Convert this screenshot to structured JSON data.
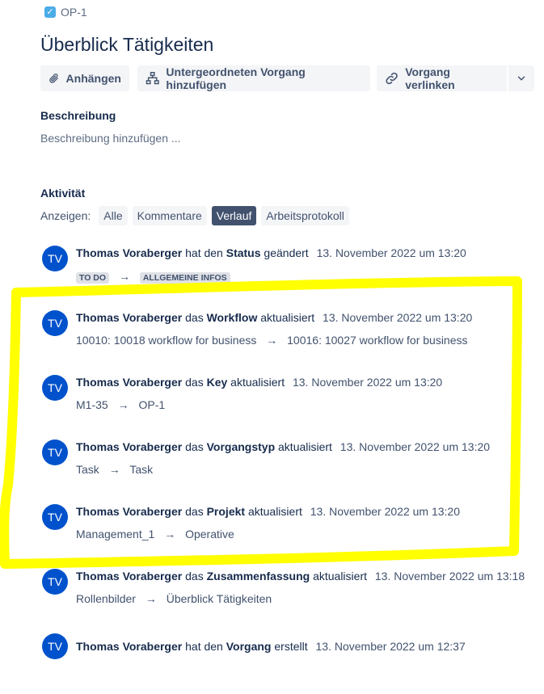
{
  "breadcrumb": {
    "key": "OP-1",
    "check_icon": "checkbox-checked-icon"
  },
  "issue": {
    "title": "Überblick Tätigkeiten"
  },
  "toolbar": {
    "attach": "Anhängen",
    "add_child": "Untergeordneten Vorgang hinzufügen",
    "link_issue": "Vorgang verlinken"
  },
  "description": {
    "label": "Beschreibung",
    "placeholder": "Beschreibung hinzufügen ..."
  },
  "activity": {
    "label": "Aktivität",
    "show_label": "Anzeigen:",
    "filters": [
      "Alle",
      "Kommentare",
      "Verlauf",
      "Arbeitsprotokoll"
    ],
    "active_filter": "Verlauf"
  },
  "entries": [
    {
      "initials": "TV",
      "author": "Thomas Voraberger",
      "pre": "hat den",
      "field": "Status",
      "post": "geändert",
      "time": "13. November 2022 um 13:20",
      "from": "TO DO",
      "to": "ALLGEMEINE INFOS"
    },
    {
      "initials": "TV",
      "author": "Thomas Voraberger",
      "pre": "das",
      "field": "Workflow",
      "post": "aktualisiert",
      "time": "13. November 2022 um 13:20",
      "from": "10010: 10018 workflow for business",
      "to": "10016: 10027 workflow for business"
    },
    {
      "initials": "TV",
      "author": "Thomas Voraberger",
      "pre": "das",
      "field": "Key",
      "post": "aktualisiert",
      "time": "13. November 2022 um 13:20",
      "from": "M1-35",
      "to": "OP-1"
    },
    {
      "initials": "TV",
      "author": "Thomas Voraberger",
      "pre": "das",
      "field": "Vorgangstyp",
      "post": "aktualisiert",
      "time": "13. November 2022 um 13:20",
      "from": "Task",
      "to": "Task"
    },
    {
      "initials": "TV",
      "author": "Thomas Voraberger",
      "pre": "das",
      "field": "Projekt",
      "post": "aktualisiert",
      "time": "13. November 2022 um 13:20",
      "from": "Management_1",
      "to": "Operative"
    },
    {
      "initials": "TV",
      "author": "Thomas Voraberger",
      "pre": "das",
      "field": "Zusammenfassung",
      "post": "aktualisiert",
      "time": "13. November 2022 um 13:18",
      "from": "Rollenbilder",
      "to": "Überblick Tätigkeiten"
    },
    {
      "initials": "TV",
      "author": "Thomas Voraberger",
      "pre": "hat den",
      "field": "Vorgang",
      "post": "erstellt",
      "time": "13. November 2022 um 12:37"
    }
  ],
  "arrow_glyph": "→",
  "colors": {
    "avatar": "#0052cc",
    "highlight": "#ffff00",
    "active_chip": "#42526e"
  }
}
